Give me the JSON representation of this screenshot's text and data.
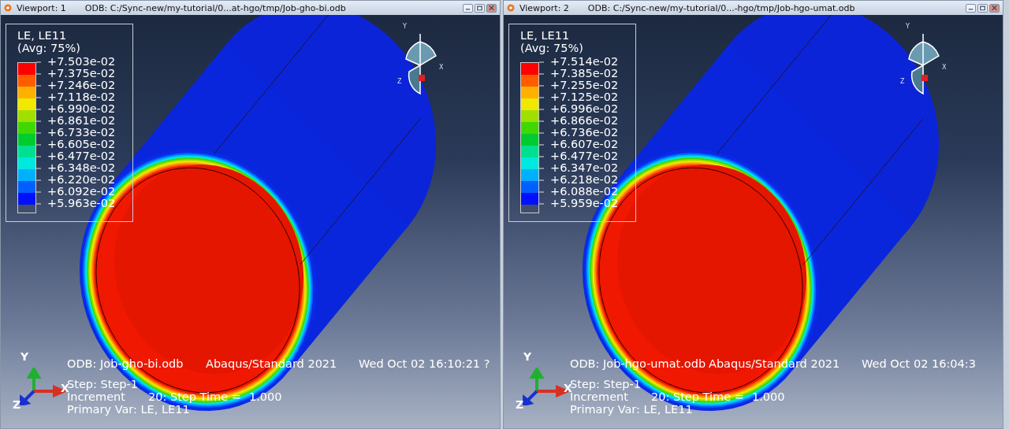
{
  "viewports": [
    {
      "title_bar": {
        "viewport_label": "Viewport: 1",
        "odb_path": "ODB: C:/Sync-new/my-tutorial/0...at-hgo/tmp/Job-gho-bi.odb"
      },
      "legend": {
        "title": "LE, LE11",
        "averaging": "(Avg: 75%)",
        "values": [
          "+7.503e-02",
          "+7.375e-02",
          "+7.246e-02",
          "+7.118e-02",
          "+6.990e-02",
          "+6.861e-02",
          "+6.733e-02",
          "+6.605e-02",
          "+6.477e-02",
          "+6.348e-02",
          "+6.220e-02",
          "+6.092e-02",
          "+5.963e-02"
        ],
        "bands": [
          {
            "color": "#ff0000"
          },
          {
            "color": "#ff5c00"
          },
          {
            "color": "#ffb000"
          },
          {
            "color": "#f0e800"
          },
          {
            "color": "#a0e000"
          },
          {
            "color": "#40d800"
          },
          {
            "color": "#00cc30"
          },
          {
            "color": "#00e090"
          },
          {
            "color": "#00e8e0"
          },
          {
            "color": "#00b0ff"
          },
          {
            "color": "#0060ff"
          },
          {
            "color": "#0010ff"
          }
        ]
      },
      "view_glyph": {
        "y": "Y",
        "x": "X",
        "z": "Z"
      },
      "axis_triad": {
        "y": "Y",
        "x": "X",
        "z": "Z"
      },
      "info": {
        "odb": "ODB: Job-gho-bi.odb",
        "product": "Abaqus/Standard 2021",
        "date": "Wed Oct 02 16:10:21 ?",
        "step": "Step: Step-1",
        "increment": "Increment",
        "increment_number": "20: Step Time =",
        "step_time": "1.000",
        "primary_var": "Primary Var: LE, LE11"
      }
    },
    {
      "title_bar": {
        "viewport_label": "Viewport: 2",
        "odb_path": "ODB: C:/Sync-new/my-tutorial/0...-hgo/tmp/Job-hgo-umat.odb"
      },
      "legend": {
        "title": "LE, LE11",
        "averaging": "(Avg: 75%)",
        "values": [
          "+7.514e-02",
          "+7.385e-02",
          "+7.255e-02",
          "+7.125e-02",
          "+6.996e-02",
          "+6.866e-02",
          "+6.736e-02",
          "+6.607e-02",
          "+6.477e-02",
          "+6.347e-02",
          "+6.218e-02",
          "+6.088e-02",
          "+5.959e-02"
        ],
        "bands": [
          {
            "color": "#ff0000"
          },
          {
            "color": "#ff5c00"
          },
          {
            "color": "#ffb000"
          },
          {
            "color": "#f0e800"
          },
          {
            "color": "#a0e000"
          },
          {
            "color": "#40d800"
          },
          {
            "color": "#00cc30"
          },
          {
            "color": "#00e090"
          },
          {
            "color": "#00e8e0"
          },
          {
            "color": "#00b0ff"
          },
          {
            "color": "#0060ff"
          },
          {
            "color": "#0010ff"
          }
        ]
      },
      "view_glyph": {
        "y": "Y",
        "x": "X",
        "z": "Z"
      },
      "axis_triad": {
        "y": "Y",
        "x": "X",
        "z": "Z"
      },
      "info": {
        "odb": "ODB: Job-hgo-umat.odb",
        "product": "Abaqus/Standard 2021",
        "date": "Wed Oct 02 16:04:3",
        "step": "Step: Step-1",
        "increment": "Increment",
        "increment_number": "20: Step Time =",
        "step_time": "1.000",
        "primary_var": "Primary Var: LE, LE11"
      }
    }
  ]
}
